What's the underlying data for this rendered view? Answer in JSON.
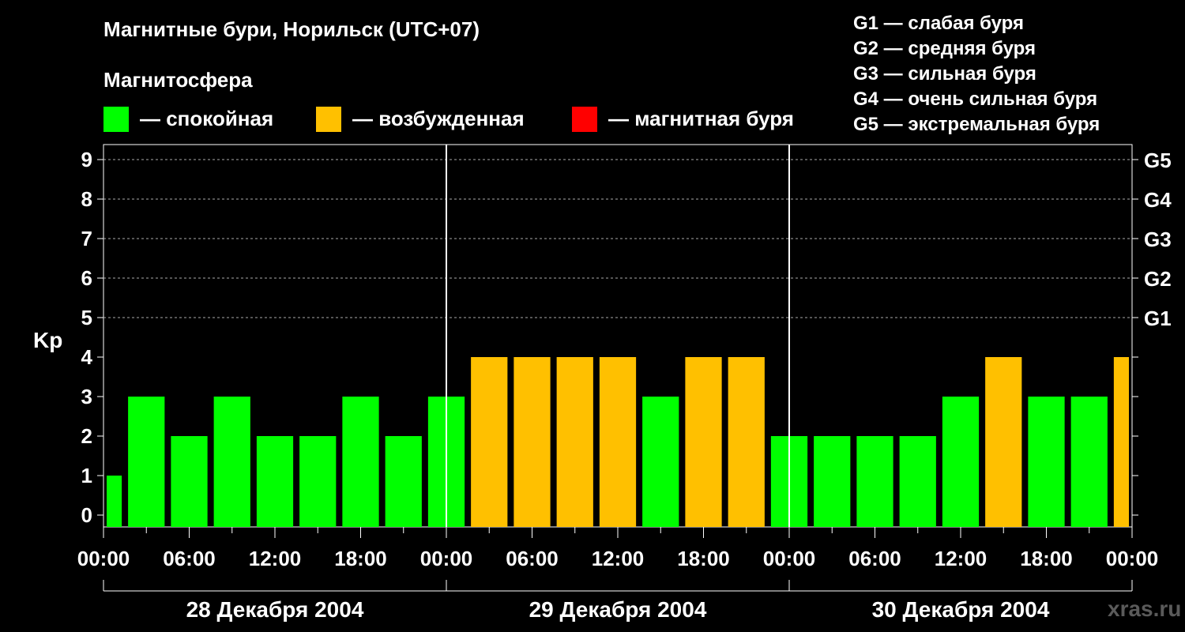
{
  "title": "Магнитные бури, Норильск (UTC+07)",
  "subtitle": "Магнитосфера",
  "legend": [
    {
      "label": "— спокойная",
      "color": "#00ff00"
    },
    {
      "label": "— возбужденная",
      "color": "#ffc000"
    },
    {
      "label": "— магнитная буря",
      "color": "#ff0000"
    }
  ],
  "g_legend": [
    "G1 — слабая буря",
    "G2 — средняя буря",
    "G3 — сильная буря",
    "G4 — очень сильная буря",
    "G5 — экстремальная буря"
  ],
  "watermark": "xras.ru",
  "chart_data": {
    "type": "bar",
    "ylabel": "Kp",
    "ylim": [
      0,
      9
    ],
    "y_ticks": [
      "0",
      "1",
      "2",
      "3",
      "4",
      "5",
      "6",
      "7",
      "8",
      "9"
    ],
    "g_ticks": [
      {
        "kp": 5,
        "label": "G1"
      },
      {
        "kp": 6,
        "label": "G2"
      },
      {
        "kp": 7,
        "label": "G3"
      },
      {
        "kp": 8,
        "label": "G4"
      },
      {
        "kp": 9,
        "label": "G5"
      }
    ],
    "x_tick_labels": [
      "00:00",
      "06:00",
      "12:00",
      "18:00",
      "00:00",
      "06:00",
      "12:00",
      "18:00",
      "00:00",
      "06:00",
      "12:00",
      "18:00",
      "00:00"
    ],
    "days": [
      "28 Декабря 2004",
      "29 Декабря 2004",
      "30 Декабря 2004"
    ],
    "bar_hours": [
      0,
      3,
      6,
      9,
      12,
      15,
      18,
      21,
      24,
      27,
      30,
      33,
      36,
      39,
      42,
      45,
      48,
      51,
      54,
      57,
      60,
      63,
      66,
      69,
      72
    ],
    "values": [
      1,
      3,
      2,
      3,
      2,
      2,
      3,
      2,
      3,
      4,
      4,
      4,
      4,
      3,
      4,
      4,
      2,
      2,
      2,
      2,
      3,
      4,
      3,
      3,
      4
    ],
    "colors": {
      "quiet": "#00ff00",
      "active": "#ffc000",
      "storm": "#ff0000"
    },
    "grid": true
  }
}
